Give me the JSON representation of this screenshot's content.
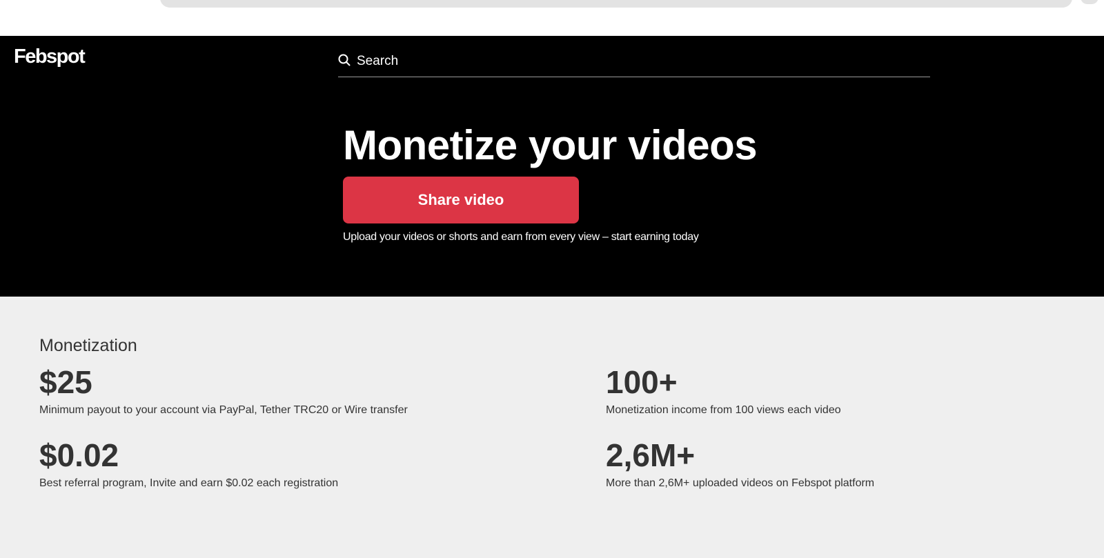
{
  "header": {
    "logo_text": "Febspot",
    "search": {
      "placeholder": "Search",
      "value": ""
    }
  },
  "hero": {
    "title": "Monetize your videos",
    "cta_label": "Share video",
    "subtitle": "Upload your videos or shorts and earn from every view – start earning today",
    "accent_color": "#dc3545"
  },
  "monetization": {
    "title": "Monetization",
    "stats": [
      {
        "value": "$25",
        "description": "Minimum payout to your account via PayPal, Tether TRC20 or Wire transfer"
      },
      {
        "value": "100+",
        "description": "Monetization income from 100 views each video"
      },
      {
        "value": "$0.02",
        "description": "Best referral program, Invite and earn $0.02 each registration"
      },
      {
        "value": "2,6M+",
        "description": "More than 2,6M+ uploaded videos on Febspot platform"
      }
    ]
  },
  "icons": {
    "search": "search-icon"
  }
}
